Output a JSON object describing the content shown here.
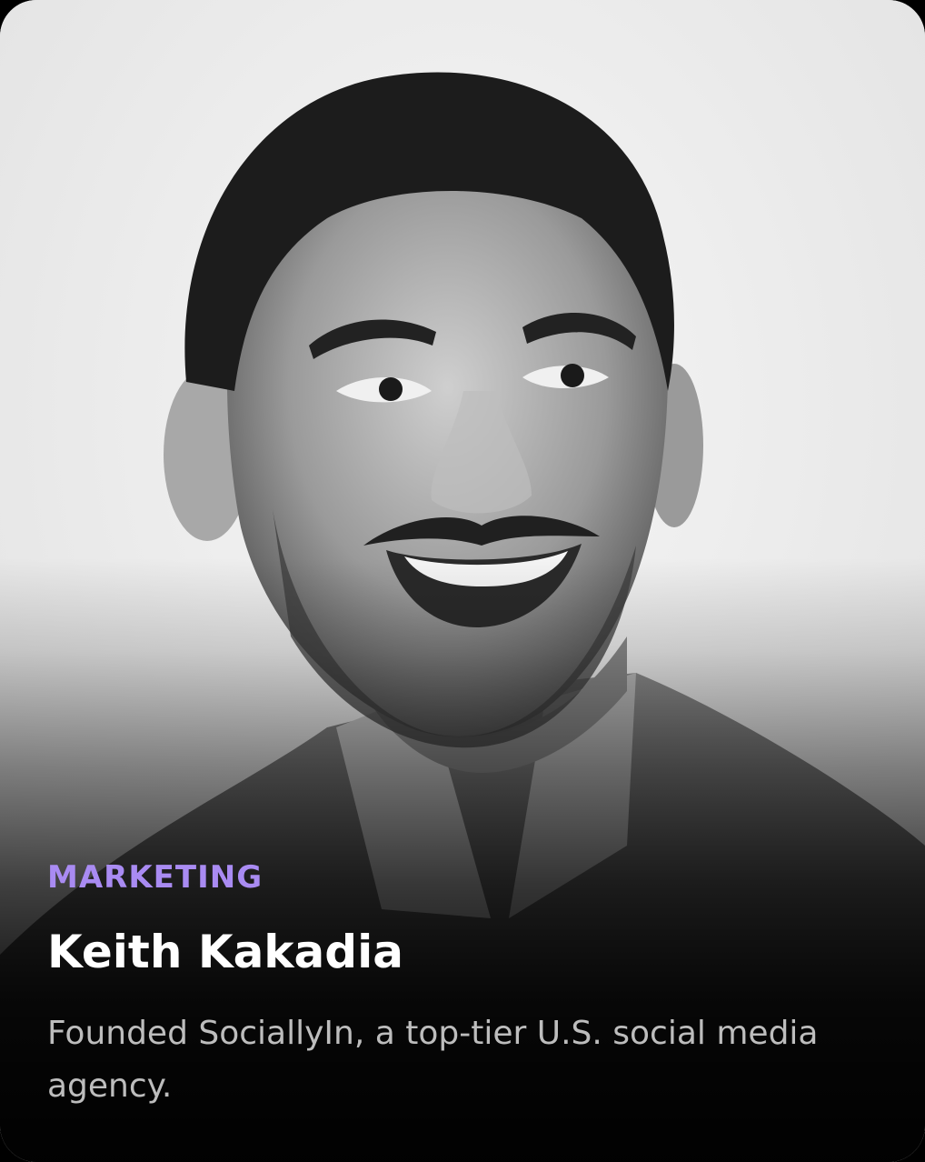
{
  "profile": {
    "category": "MARKETING",
    "name": "Keith Kakadia",
    "description": "Founded SociallyIn, a top-tier U.S. social media agency."
  },
  "colors": {
    "category_accent": "#a98bf2",
    "name_text": "#ffffff",
    "description_text": "#bdbdbd",
    "card_background": "#efefef"
  },
  "icons": {
    "portrait": "portrait-photo"
  }
}
